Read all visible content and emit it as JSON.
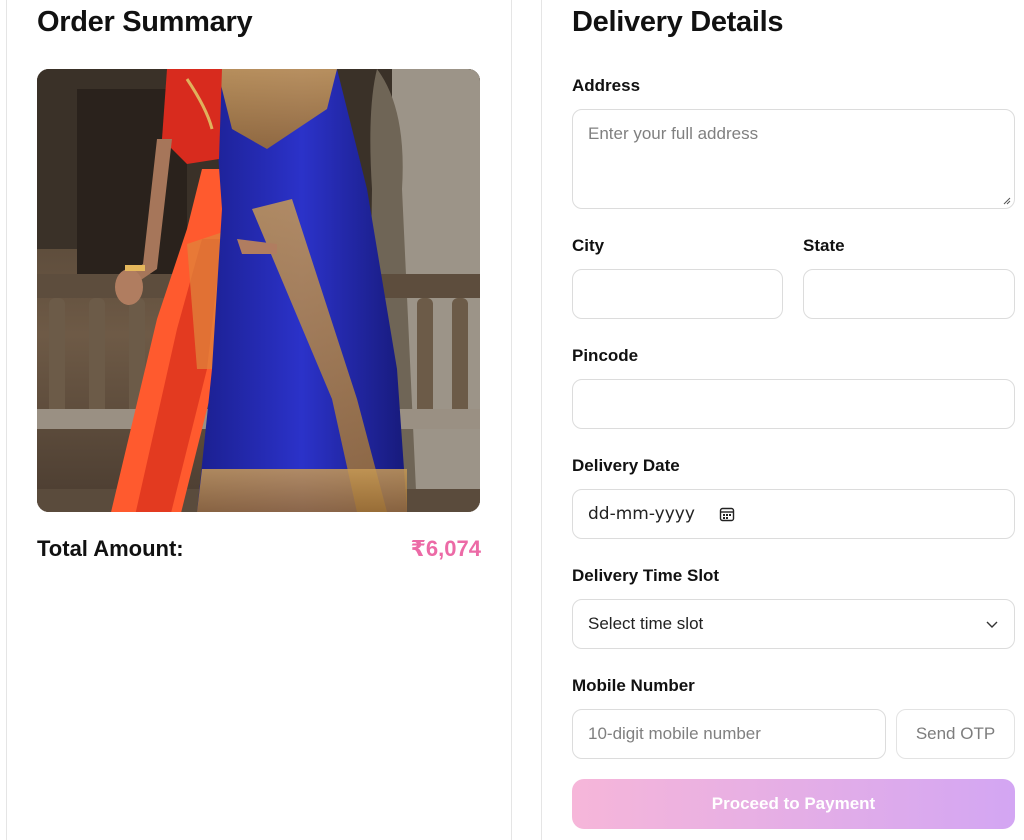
{
  "order_summary": {
    "title": "Order Summary",
    "product_image": "saree-photo",
    "total_label": "Total Amount:",
    "total_value": "₹6,074",
    "total_color": "#ec6aa6"
  },
  "delivery": {
    "title": "Delivery Details",
    "address": {
      "label": "Address",
      "placeholder": "Enter your full address",
      "value": ""
    },
    "city": {
      "label": "City",
      "value": ""
    },
    "state": {
      "label": "State",
      "value": ""
    },
    "pincode": {
      "label": "Pincode",
      "value": ""
    },
    "date": {
      "label": "Delivery Date",
      "value": "dd-mm-yyyy",
      "icon": "calendar-icon"
    },
    "time_slot": {
      "label": "Delivery Time Slot",
      "selected": "Select time slot",
      "icon": "chevron-down-icon"
    },
    "mobile": {
      "label": "Mobile Number",
      "placeholder": "10-digit mobile number",
      "value": "",
      "otp_label": "Send OTP"
    },
    "proceed_label": "Proceed to Payment",
    "proceed_gradient": [
      "#f6b6d9",
      "#d3a6f3"
    ]
  }
}
